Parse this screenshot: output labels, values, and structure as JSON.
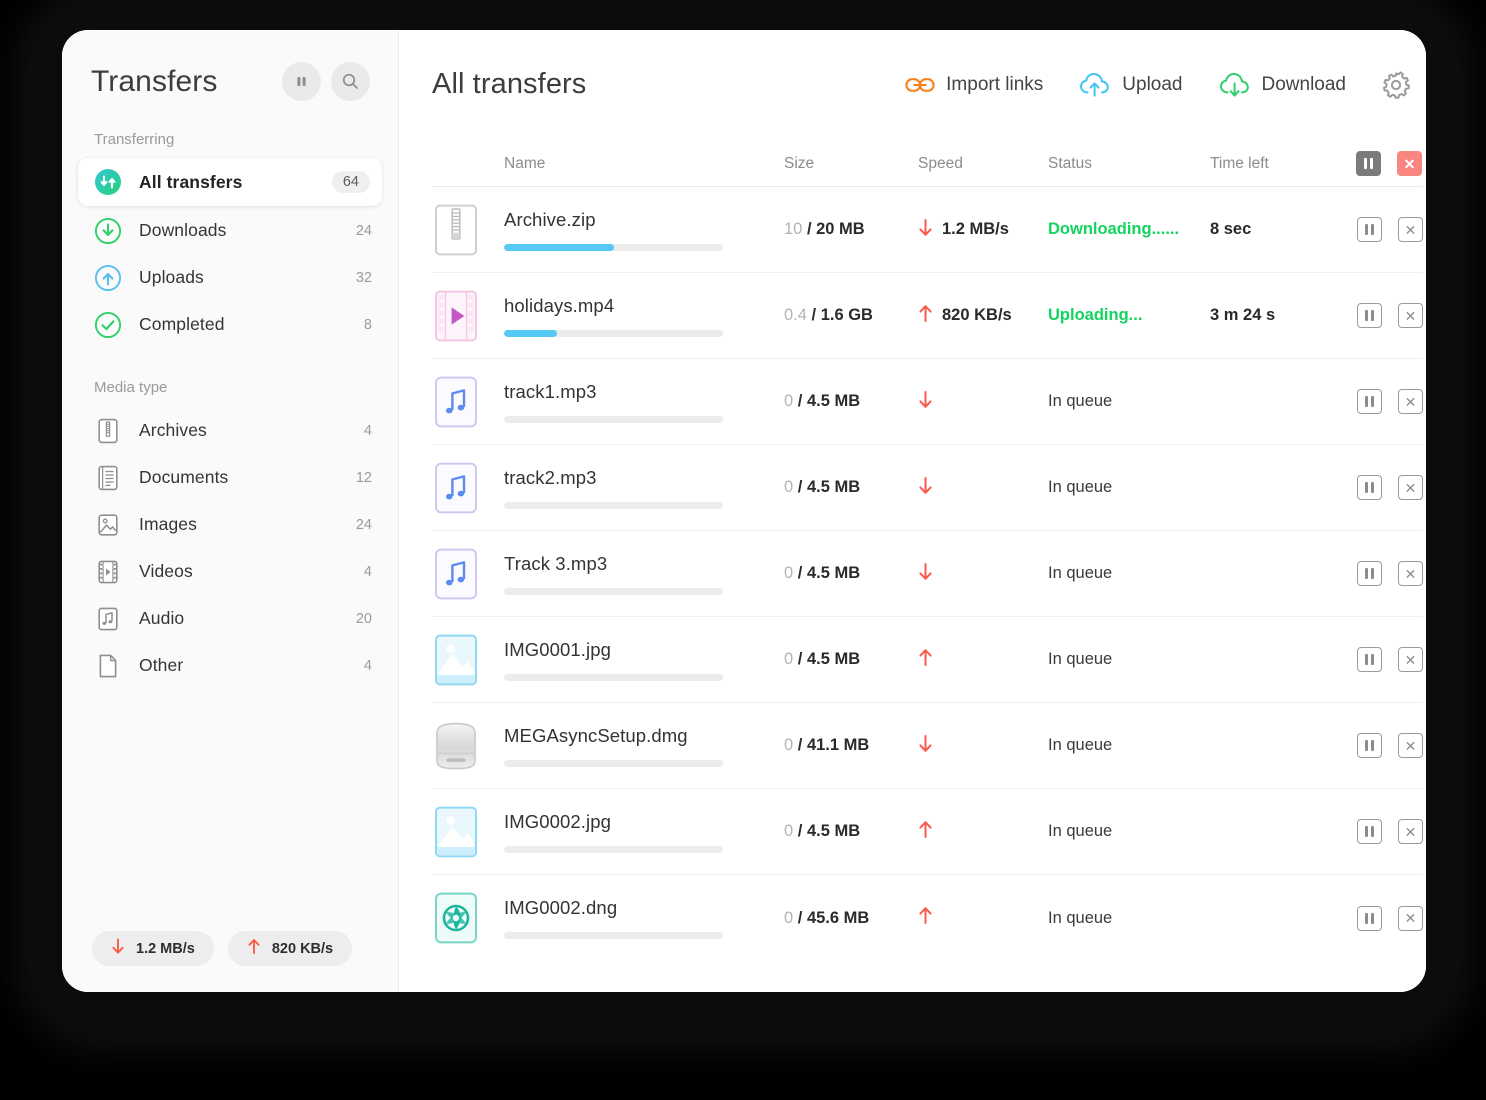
{
  "window": {
    "sidebar": {
      "title": "Transfers",
      "buttons": [
        {
          "name": "pause-all-button",
          "icon": "pause-icon"
        },
        {
          "name": "search-button",
          "icon": "search-icon"
        }
      ],
      "section_transferring": {
        "label": "Transferring",
        "items": [
          {
            "label": "All transfers",
            "count": "64",
            "icon": "transfers-updown-icon",
            "active": true
          },
          {
            "label": "Downloads",
            "count": "24",
            "icon": "download-circle-icon",
            "active": false
          },
          {
            "label": "Uploads",
            "count": "32",
            "icon": "upload-circle-icon",
            "active": false
          },
          {
            "label": "Completed",
            "count": "8",
            "icon": "check-circle-icon",
            "active": false
          }
        ]
      },
      "section_media": {
        "label": "Media type",
        "items": [
          {
            "label": "Archives",
            "count": "4",
            "icon": "archive-file-icon"
          },
          {
            "label": "Documents",
            "count": "12",
            "icon": "document-file-icon"
          },
          {
            "label": "Images",
            "count": "24",
            "icon": "image-file-icon"
          },
          {
            "label": "Videos",
            "count": "4",
            "icon": "video-file-icon"
          },
          {
            "label": "Audio",
            "count": "20",
            "icon": "audio-file-icon"
          },
          {
            "label": "Other",
            "count": "4",
            "icon": "other-file-icon"
          }
        ]
      },
      "footer": {
        "download_speed": "1.2 MB/s",
        "upload_speed": "820 KB/s"
      }
    },
    "main": {
      "title": "All transfers",
      "toolbar": [
        {
          "label": "Import links",
          "icon": "link-icon",
          "color": "#f7831d"
        },
        {
          "label": "Upload",
          "icon": "cloud-upload-icon",
          "color": "#3fc4f3"
        },
        {
          "label": "Download",
          "icon": "cloud-download-icon",
          "color": "#2fd06a"
        },
        {
          "label": "",
          "icon": "gear-icon",
          "color": "#9b9b9b"
        }
      ],
      "table": {
        "headers": {
          "name": "Name",
          "size": "Size",
          "speed": "Speed",
          "status": "Status",
          "time_left": "Time left"
        },
        "header_actions": [
          {
            "name": "pause-all-header-button",
            "icon": "pause-icon",
            "style": "filled-gray"
          },
          {
            "name": "cancel-all-header-button",
            "icon": "close-icon",
            "style": "filled-red"
          }
        ],
        "rows": [
          {
            "icon": "archive-file-icon",
            "name": "Archive.zip",
            "progress_pct": 50,
            "size_current": "10",
            "size_total": "/ 20 MB",
            "speed_dir": "down",
            "speed": "1.2 MB/s",
            "status": "Downloading......",
            "status_state": "active",
            "time_left": "8 sec"
          },
          {
            "icon": "video-file-icon",
            "name": "holidays.mp4",
            "progress_pct": 24,
            "size_current": "0.4",
            "size_total": "/ 1.6 GB",
            "speed_dir": "up",
            "speed": "820 KB/s",
            "status": "Uploading...",
            "status_state": "active",
            "time_left": "3 m 24 s"
          },
          {
            "icon": "audio-file-icon",
            "name": "track1.mp3",
            "progress_pct": 0,
            "size_current": "0",
            "size_total": "/ 4.5 MB",
            "speed_dir": "down",
            "speed": "",
            "status": "In queue",
            "status_state": "queue",
            "time_left": ""
          },
          {
            "icon": "audio-file-icon",
            "name": "track2.mp3",
            "progress_pct": 0,
            "size_current": "0",
            "size_total": "/ 4.5 MB",
            "speed_dir": "down",
            "speed": "",
            "status": "In queue",
            "status_state": "queue",
            "time_left": ""
          },
          {
            "icon": "audio-file-icon",
            "name": "Track 3.mp3",
            "progress_pct": 0,
            "size_current": "0",
            "size_total": "/ 4.5 MB",
            "speed_dir": "down",
            "speed": "",
            "status": "In queue",
            "status_state": "queue",
            "time_left": ""
          },
          {
            "icon": "image-file-icon",
            "name": "IMG0001.jpg",
            "progress_pct": 0,
            "size_current": "0",
            "size_total": "/ 4.5 MB",
            "speed_dir": "up",
            "speed": "",
            "status": "In queue",
            "status_state": "queue",
            "time_left": ""
          },
          {
            "icon": "disk-image-icon",
            "name": "MEGAsyncSetup.dmg",
            "progress_pct": 0,
            "size_current": "0",
            "size_total": "/ 41.1 MB",
            "speed_dir": "down",
            "speed": "",
            "status": "In queue",
            "status_state": "queue",
            "time_left": ""
          },
          {
            "icon": "image-file-icon",
            "name": "IMG0002.jpg",
            "progress_pct": 0,
            "size_current": "0",
            "size_total": "/ 4.5 MB",
            "speed_dir": "up",
            "speed": "",
            "status": "In queue",
            "status_state": "queue",
            "time_left": ""
          },
          {
            "icon": "raw-image-icon",
            "name": "IMG0002.dng",
            "progress_pct": 0,
            "size_current": "0",
            "size_total": "/ 45.6 MB",
            "speed_dir": "up",
            "speed": "",
            "status": "In queue",
            "status_state": "queue",
            "time_left": ""
          }
        ],
        "row_actions": {
          "pause": {
            "name": "pause-transfer-button",
            "icon": "pause-icon"
          },
          "cancel": {
            "name": "cancel-transfer-button",
            "icon": "close-icon"
          }
        }
      }
    }
  },
  "colors": {
    "progress": "#56c8f5",
    "status_active": "#13d45f",
    "arrow_red": "#fb5a4b",
    "accent_orange": "#f7831d",
    "accent_blue": "#3fc4f3",
    "accent_green": "#2fd06a"
  }
}
